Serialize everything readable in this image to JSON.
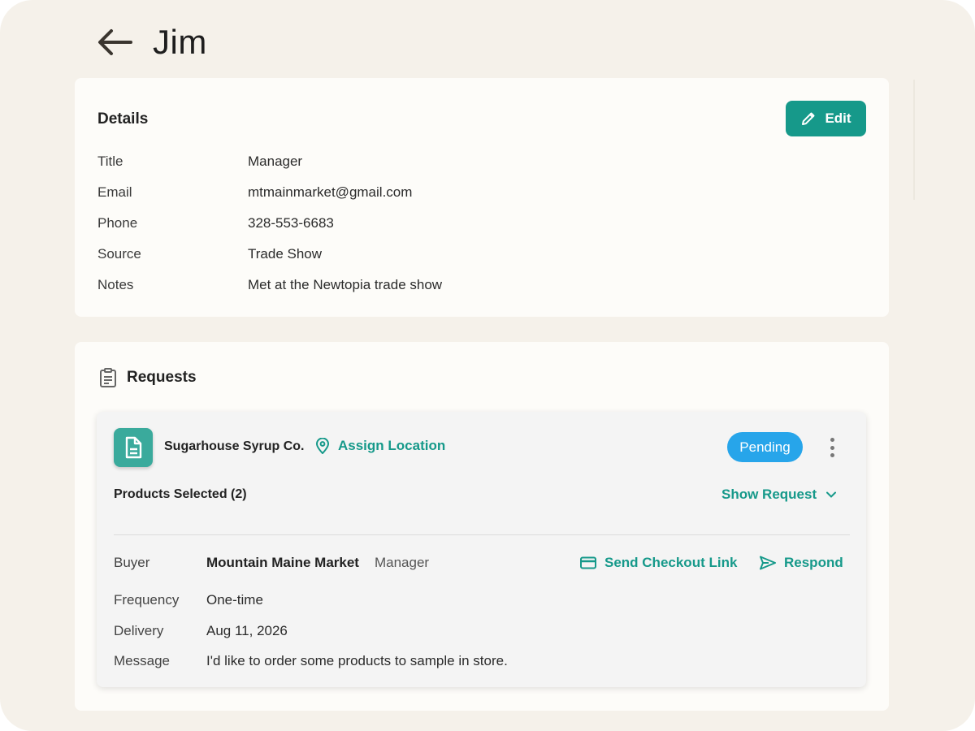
{
  "header": {
    "title": "Jim"
  },
  "details": {
    "heading": "Details",
    "edit_label": "Edit",
    "rows": [
      {
        "label": "Title",
        "value": "Manager"
      },
      {
        "label": "Email",
        "value": "mtmainmarket@gmail.com"
      },
      {
        "label": "Phone",
        "value": "328-553-6683"
      },
      {
        "label": "Source",
        "value": "Trade Show"
      },
      {
        "label": "Notes",
        "value": "Met at the Newtopia trade show"
      }
    ]
  },
  "requests": {
    "heading": "Requests",
    "item": {
      "company": "Sugarhouse Syrup Co.",
      "assign_location_label": "Assign Location",
      "status": "Pending",
      "products_selected": "Products Selected (2)",
      "show_request_label": "Show Request",
      "send_checkout_label": "Send Checkout Link",
      "respond_label": "Respond",
      "buyer": {
        "label": "Buyer",
        "name": "Mountain Maine Market",
        "role": "Manager"
      },
      "frequency": {
        "label": "Frequency",
        "value": "One-time"
      },
      "delivery": {
        "label": "Delivery",
        "value": "Aug 11, 2026"
      },
      "message": {
        "label": "Message",
        "value": "I'd like to order some products to sample in store."
      }
    }
  },
  "colors": {
    "accent": "#16998a",
    "status_pending": "#27a5ea",
    "background": "#f5f1ea",
    "card": "#fdfcf9"
  },
  "icons": [
    "back-arrow-icon",
    "pencil-icon",
    "clipboard-icon",
    "document-icon",
    "location-pin-icon",
    "kebab-menu-icon",
    "chevron-down-icon",
    "credit-card-icon",
    "send-icon"
  ]
}
